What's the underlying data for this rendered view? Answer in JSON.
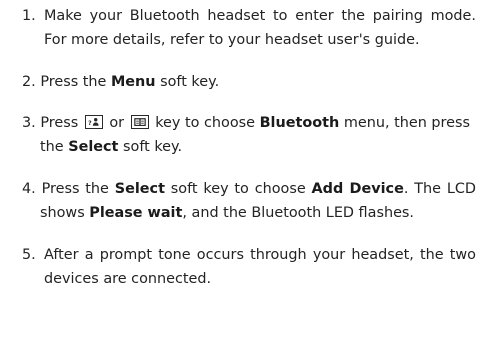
{
  "steps": [
    {
      "num": "1.",
      "text": "Make your Bluetooth headset to enter the pairing mode. For more details, refer to your headset user's guide."
    },
    {
      "num": "2.",
      "pre": "Press the ",
      "bold1": "Menu",
      "post": " soft key."
    },
    {
      "num": "3.",
      "pre": "Press ",
      "or": " or ",
      "mid": " key to choose ",
      "bold1": "Bluetooth",
      "mid2": " menu, then press the ",
      "bold2": "Select",
      "post": " soft key.",
      "key1_icon": "contacts-key-icon",
      "key2_icon": "phonebook-key-icon"
    },
    {
      "num": "4.",
      "pre": "Press the ",
      "bold1": "Select",
      "mid": " soft key to choose ",
      "bold2": "Add Device",
      "mid2": ". The LCD shows ",
      "bold3": "Please wait",
      "post": ", and the Bluetooth LED flashes."
    },
    {
      "num": "5.",
      "text": "After a prompt tone occurs through your headset, the two devices are connected."
    }
  ]
}
